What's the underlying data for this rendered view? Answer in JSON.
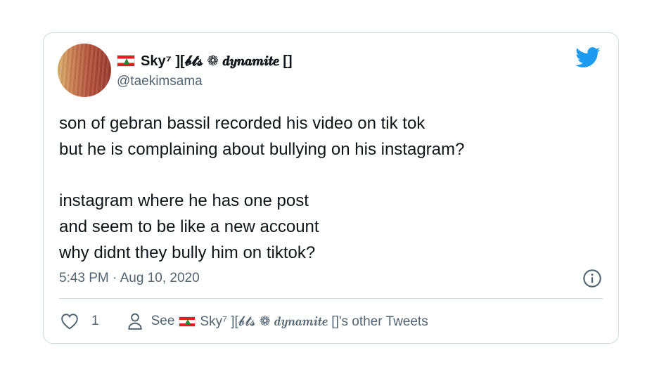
{
  "tweet": {
    "author_name": "Sky⁷ ][𝓫𝓽𝓼 ❁ 𝒅𝒚𝒏𝒂𝒎𝒊𝒕𝒆 []",
    "author_handle": "@taekimsama",
    "text_lines_1": [
      "son of gebran bassil recorded his video on tik tok",
      "but he is complaining about bullying on his instagram?"
    ],
    "text_lines_2": [
      "instagram where he has one post",
      "and seem to be like a new account",
      "why didnt they bully him on tiktok?"
    ],
    "timestamp": "5:43 PM · Aug 10, 2020",
    "like_count": "1",
    "see_prefix": "See",
    "see_suffix": "Sky⁷ ][𝓫𝓽𝓼 ❁ 𝒅𝒚𝒏𝒂𝒎𝒊𝒕𝒆 []'s other Tweets"
  },
  "icons": {
    "flag": "lebanon-flag-icon",
    "brand": "twitter-bird-icon",
    "info": "info-icon",
    "like": "heart-icon",
    "profile": "person-icon"
  },
  "colors": {
    "twitter_blue": "#1d9bf0",
    "text_primary": "#0f1419",
    "text_secondary": "#536471",
    "border": "#cfd9de"
  }
}
